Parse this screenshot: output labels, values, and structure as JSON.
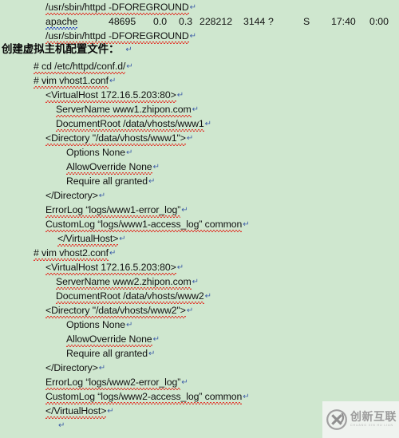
{
  "document": {
    "background_color": "#cfe7cf",
    "text_color": "#111111",
    "spelling_underline_color": "#e03b2f",
    "grammar_underline_color": "#2f49c0",
    "pilcrow_glyph": "↵",
    "pilcrow_color": "#3f5fa8"
  },
  "lines": [
    {
      "id": "l01",
      "indent": 57,
      "text": "/usr/sbin/httpd -DFOREGROUND",
      "pilcrow": true
    },
    {
      "id": "l03",
      "indent": 57,
      "text": "/usr/sbin/httpd -DFOREGROUND",
      "pilcrow": true
    },
    {
      "id": "l04",
      "indent": 2,
      "text": "创建虚拟主机配置文件：",
      "pilcrow": true
    },
    {
      "id": "l05",
      "indent": 42,
      "text": "# cd /etc/httpd/conf.d/",
      "pilcrow": true
    },
    {
      "id": "l06",
      "indent": 42,
      "text": "# vim vhost1.conf",
      "pilcrow": true
    },
    {
      "id": "l07",
      "indent": 57,
      "text": "<VirtualHost 172.16.5.203:80>",
      "pilcrow": true
    },
    {
      "id": "l08",
      "indent": 70,
      "text": "ServerName www1.zhipon.com",
      "pilcrow": true
    },
    {
      "id": "l09",
      "indent": 70,
      "text": "DocumentRoot /data/vhosts/www1",
      "pilcrow": true
    },
    {
      "id": "l10",
      "indent": 57,
      "text": "<Directory \"/data/vhosts/www1\">",
      "pilcrow": true
    },
    {
      "id": "l11",
      "indent": 83,
      "text": "Options None",
      "pilcrow": true
    },
    {
      "id": "l12",
      "indent": 83,
      "text": "AllowOverride None",
      "pilcrow": true
    },
    {
      "id": "l13",
      "indent": 83,
      "text": "Require all granted",
      "pilcrow": true
    },
    {
      "id": "l14",
      "indent": 57,
      "text": "</Directory>",
      "pilcrow": true
    },
    {
      "id": "l15",
      "indent": 57,
      "text": "ErrorLog “logs/www1-error_log”",
      "pilcrow": true
    },
    {
      "id": "l16",
      "indent": 57,
      "text": "CustomLog “logs/www1-access_log” common",
      "pilcrow": true
    },
    {
      "id": "l17",
      "indent": 72,
      "text": "</VirtualHost>",
      "pilcrow": true
    },
    {
      "id": "l18",
      "indent": 42,
      "text": "# vim vhost2.conf",
      "pilcrow": true
    },
    {
      "id": "l19",
      "indent": 57,
      "text": "<VirtualHost 172.16.5.203:80>",
      "pilcrow": true
    },
    {
      "id": "l20",
      "indent": 70,
      "text": "ServerName www2.zhipon.com",
      "pilcrow": true
    },
    {
      "id": "l21",
      "indent": 70,
      "text": "DocumentRoot /data/vhosts/www2",
      "pilcrow": true
    },
    {
      "id": "l22",
      "indent": 57,
      "text": "<Directory \"/data/vhosts/www2\">",
      "pilcrow": true
    },
    {
      "id": "l23",
      "indent": 83,
      "text": "Options None",
      "pilcrow": true
    },
    {
      "id": "l24",
      "indent": 83,
      "text": "AllowOverride None",
      "pilcrow": true
    },
    {
      "id": "l25",
      "indent": 83,
      "text": "Require all granted",
      "pilcrow": true
    },
    {
      "id": "l26",
      "indent": 57,
      "text": "</Directory>",
      "pilcrow": true
    },
    {
      "id": "l27",
      "indent": 57,
      "text": "ErrorLog “logs/www2-error_log”",
      "pilcrow": true
    },
    {
      "id": "l28",
      "indent": 57,
      "text": "CustomLog “logs/www2-access_log”     common",
      "pilcrow": true
    },
    {
      "id": "l29",
      "indent": 72,
      "text": "</VirtualHost>",
      "pilcrow": true
    }
  ],
  "process_row": {
    "user": "apache",
    "pid": "48695",
    "cpu": "0.0",
    "mem": "0.3",
    "vsz": "228212",
    "rss": "3144",
    "tty": "?",
    "stat": "S",
    "start": "17:40",
    "time": "0:00"
  },
  "watermark": {
    "main_text": "创新互联",
    "sub_text": "CHUANG XIN HU LIAN",
    "logo_icon": "circle-x-logo-icon",
    "color": "#9b9b9b"
  }
}
